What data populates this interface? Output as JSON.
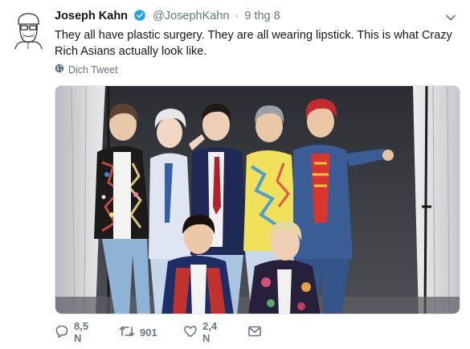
{
  "tweet": {
    "author_name": "Joseph Kahn",
    "handle": "@JosephKahn",
    "separator": "·",
    "time": "9 thg 8",
    "text": "They all have plastic surgery. They are all wearing lipstick. This is what Crazy Rich Asians actually look like.",
    "translate_label": "Dịch Tweet",
    "verified_color": "#1da1f2"
  },
  "actions": {
    "reply_count": "8,5 N",
    "retweet_count": "901",
    "like_count": "2,4 N"
  },
  "icons": [
    "avatar-sketch",
    "verified-badge-icon",
    "chevron-down-icon",
    "globe-icon",
    "reply-icon",
    "retweet-icon",
    "heart-icon",
    "message-icon"
  ]
}
